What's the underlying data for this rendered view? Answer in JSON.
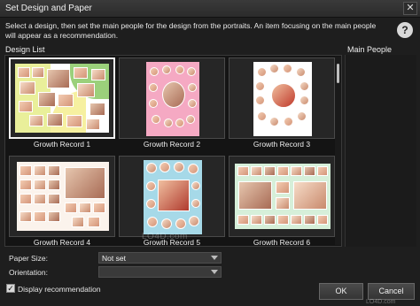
{
  "window": {
    "title": "Set Design and Paper"
  },
  "instructions": "Select a design, then set the main people for the design from the portraits. An item focusing on the main people will appear as a recommendation.",
  "design_list": {
    "label": "Design List",
    "items": [
      {
        "caption": "Growth Record 1",
        "selected": true
      },
      {
        "caption": "Growth Record 2",
        "selected": false
      },
      {
        "caption": "Growth Record 3",
        "selected": false
      },
      {
        "caption": "Growth Record 4",
        "selected": false
      },
      {
        "caption": "Growth Record 5",
        "selected": false
      },
      {
        "caption": "Growth Record 6",
        "selected": false
      }
    ]
  },
  "main_people": {
    "label": "Main People"
  },
  "paper_size": {
    "label": "Paper Size:",
    "value": "Not set"
  },
  "orientation": {
    "label": "Orientation:",
    "value": ""
  },
  "display_recommendation": {
    "label": "Display recommendation",
    "checked": true
  },
  "buttons": {
    "ok": "OK",
    "cancel": "Cancel"
  },
  "watermark": "LO4D.com",
  "watermark_small": "LO4D.com",
  "icons": {
    "help": "help-icon",
    "close": "close-icon",
    "check": "checkmark-icon",
    "dropdown": "chevron-down-icon"
  }
}
